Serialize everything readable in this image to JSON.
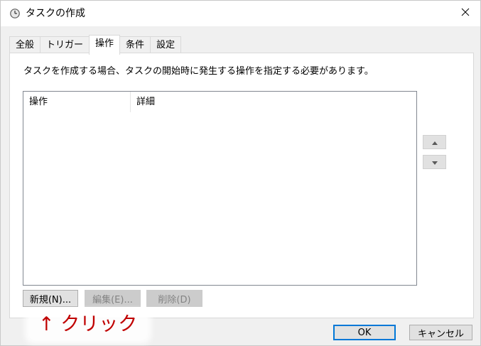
{
  "window": {
    "title": "タスクの作成",
    "icon": "clock-icon"
  },
  "tabs": [
    {
      "label": "全般",
      "active": false
    },
    {
      "label": "トリガー",
      "active": false
    },
    {
      "label": "操作",
      "active": true
    },
    {
      "label": "条件",
      "active": false
    },
    {
      "label": "設定",
      "active": false
    }
  ],
  "panel": {
    "description": "タスクを作成する場合、タスクの開始時に発生する操作を指定する必要があります。",
    "list_columns": [
      "操作",
      "詳細"
    ],
    "list_rows": []
  },
  "buttons": {
    "new": "新規(N)...",
    "edit": "編集(E)...",
    "delete": "削除(D)",
    "ok": "OK",
    "cancel": "キャンセル"
  },
  "annotation": {
    "text": "↑ クリック",
    "color": "#c00000"
  }
}
